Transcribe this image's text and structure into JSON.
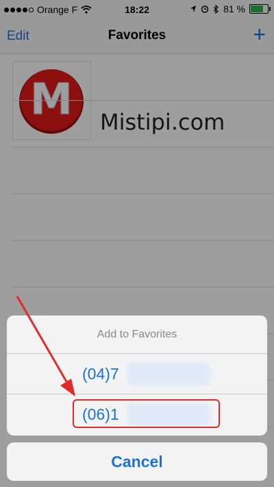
{
  "status_bar": {
    "carrier": "Orange F",
    "time": "18:22",
    "battery": "81 %",
    "battery_level": 0.81
  },
  "nav": {
    "edit_label": "Edit",
    "title": "Favorites",
    "add_label": "+"
  },
  "favorites": {
    "contact_name": "Mistipi.com",
    "logo_letter": "M"
  },
  "action_sheet": {
    "title": "Add to Favorites",
    "options": [
      {
        "label": "(04)7"
      },
      {
        "label": "(06)1"
      }
    ],
    "cancel_label": "Cancel"
  },
  "colors": {
    "accent": "#1a73d9",
    "highlight": "#e22a2a",
    "battery": "#2fb44a"
  }
}
